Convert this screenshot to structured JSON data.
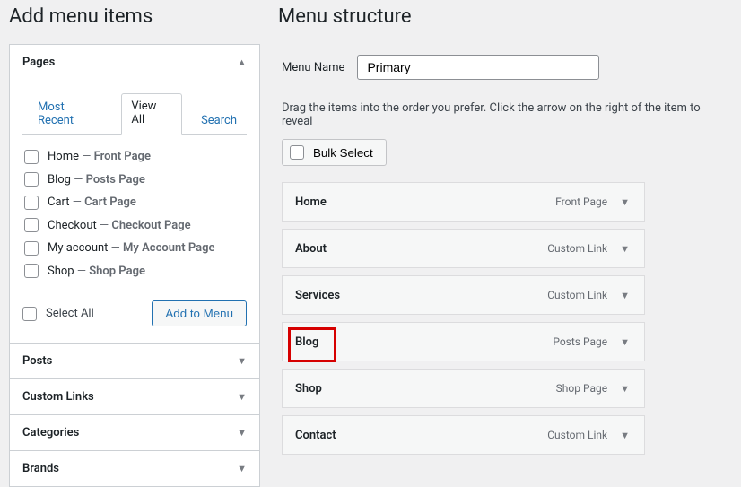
{
  "left": {
    "heading": "Add menu items",
    "panels": {
      "pages": {
        "title": "Pages",
        "tabs": {
          "recent": "Most Recent",
          "viewall": "View All",
          "search": "Search"
        },
        "items": [
          {
            "label": "Home",
            "sub": "Front Page"
          },
          {
            "label": "Blog",
            "sub": "Posts Page"
          },
          {
            "label": "Cart",
            "sub": "Cart Page"
          },
          {
            "label": "Checkout",
            "sub": "Checkout Page"
          },
          {
            "label": "My account",
            "sub": "My Account Page"
          },
          {
            "label": "Shop",
            "sub": "Shop Page"
          }
        ],
        "select_all": "Select All",
        "add_btn": "Add to Menu"
      },
      "posts": "Posts",
      "custom_links": "Custom Links",
      "categories": "Categories",
      "brands": "Brands"
    }
  },
  "right": {
    "heading": "Menu structure",
    "menu_name_label": "Menu Name",
    "menu_name_value": "Primary",
    "instructions": "Drag the items into the order you prefer. Click the arrow on the right of the item to reveal",
    "bulk_select": "Bulk Select",
    "menu_items": [
      {
        "title": "Home",
        "type": "Front Page"
      },
      {
        "title": "About",
        "type": "Custom Link"
      },
      {
        "title": "Services",
        "type": "Custom Link"
      },
      {
        "title": "Blog",
        "type": "Posts Page"
      },
      {
        "title": "Shop",
        "type": "Shop Page"
      },
      {
        "title": "Contact",
        "type": "Custom Link"
      }
    ]
  }
}
